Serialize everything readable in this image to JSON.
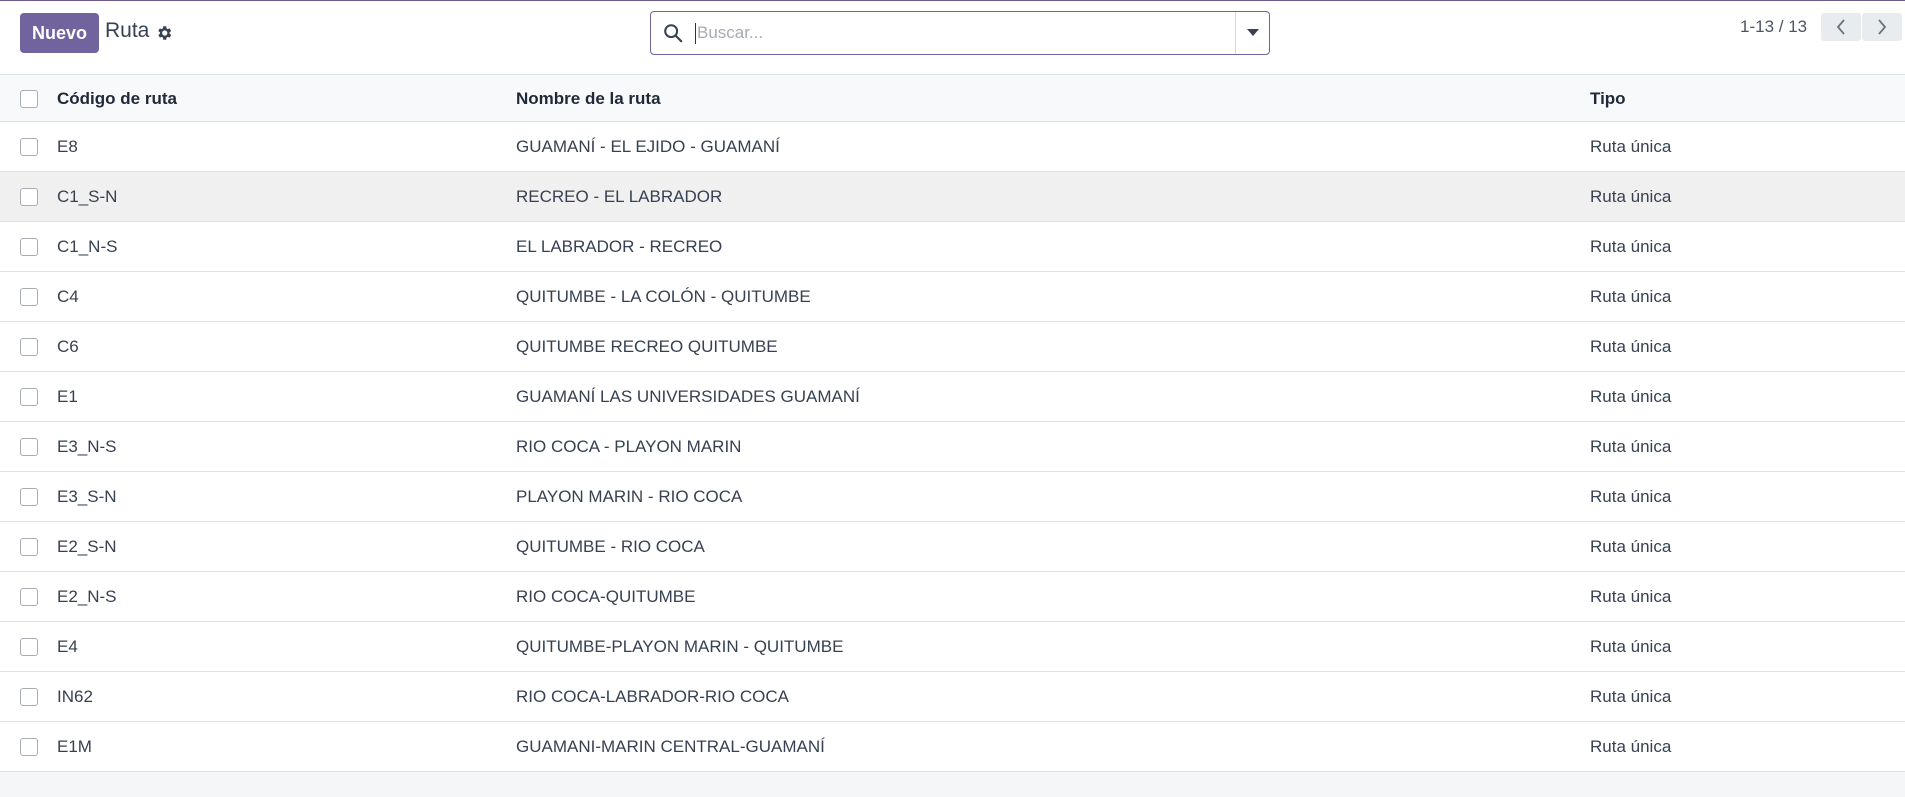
{
  "control_panel": {
    "new_button": "Nuevo",
    "title": "Ruta",
    "search_placeholder": "Buscar...",
    "pager": "1-13 / 13"
  },
  "icons": {
    "gear": "gear-icon",
    "search": "search-icon",
    "dropdown": "caret-down-icon",
    "prev": "chevron-left-icon",
    "next": "chevron-right-icon"
  },
  "colors": {
    "primary": "#71639e"
  },
  "table": {
    "headers": [
      "Código de ruta",
      "Nombre de la ruta",
      "Tipo"
    ],
    "rows": [
      [
        "E8",
        "GUAMANÍ - EL EJIDO - GUAMANÍ",
        "Ruta única"
      ],
      [
        "C1_S-N",
        "RECREO - EL LABRADOR",
        "Ruta única"
      ],
      [
        "C1_N-S",
        "EL LABRADOR - RECREO",
        "Ruta única"
      ],
      [
        "C4",
        "QUITUMBE - LA COLÓN - QUITUMBE",
        "Ruta única"
      ],
      [
        "C6",
        "QUITUMBE RECREO QUITUMBE",
        "Ruta única"
      ],
      [
        "E1",
        "GUAMANÍ LAS UNIVERSIDADES GUAMANÍ",
        "Ruta única"
      ],
      [
        "E3_N-S",
        "RIO COCA - PLAYON MARIN",
        "Ruta única"
      ],
      [
        "E3_S-N",
        "PLAYON MARIN - RIO COCA",
        "Ruta única"
      ],
      [
        "E2_S-N",
        "QUITUMBE - RIO COCA",
        "Ruta única"
      ],
      [
        "E2_N-S",
        "RIO COCA-QUITUMBE",
        "Ruta única"
      ],
      [
        "E4",
        "QUITUMBE-PLAYON MARIN - QUITUMBE",
        "Ruta única"
      ],
      [
        "IN62",
        "RIO COCA-LABRADOR-RIO COCA",
        "Ruta única"
      ],
      [
        "E1M",
        "GUAMANI-MARIN CENTRAL-GUAMANÍ",
        "Ruta única"
      ]
    ]
  }
}
